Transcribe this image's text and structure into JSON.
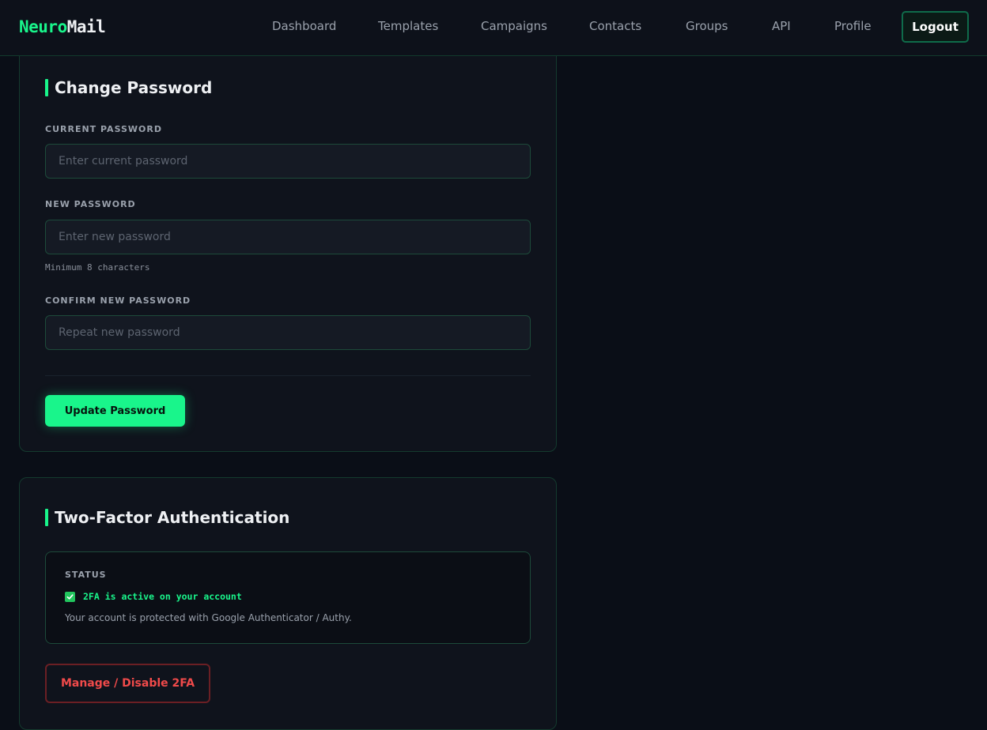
{
  "brand": {
    "part1": "Neuro",
    "part2": "Mail"
  },
  "nav": {
    "items": [
      {
        "label": "Dashboard"
      },
      {
        "label": "Templates"
      },
      {
        "label": "Campaigns"
      },
      {
        "label": "Contacts"
      },
      {
        "label": "Groups"
      },
      {
        "label": "API"
      },
      {
        "label": "Profile"
      }
    ],
    "logout_label": "Logout"
  },
  "change_password": {
    "title": "Change Password",
    "current": {
      "label": "Current Password",
      "placeholder": "Enter current password"
    },
    "new": {
      "label": "New Password",
      "placeholder": "Enter new password",
      "hint": "Minimum 8 characters"
    },
    "confirm": {
      "label": "Confirm New Password",
      "placeholder": "Repeat new password"
    },
    "submit_label": "Update Password"
  },
  "two_factor": {
    "title": "Two-Factor Authentication",
    "status_label": "STATUS",
    "status_text": "2FA is active on your account",
    "status_icon": "check-icon",
    "description": "Your account is protected with Google Authenticator / Authy.",
    "manage_label": "Manage / Disable 2FA"
  },
  "colors": {
    "background": "#0a0e17",
    "card": "#0f131c",
    "accent": "#19f58b",
    "danger": "#f04a4a",
    "border": "#143a2e"
  }
}
